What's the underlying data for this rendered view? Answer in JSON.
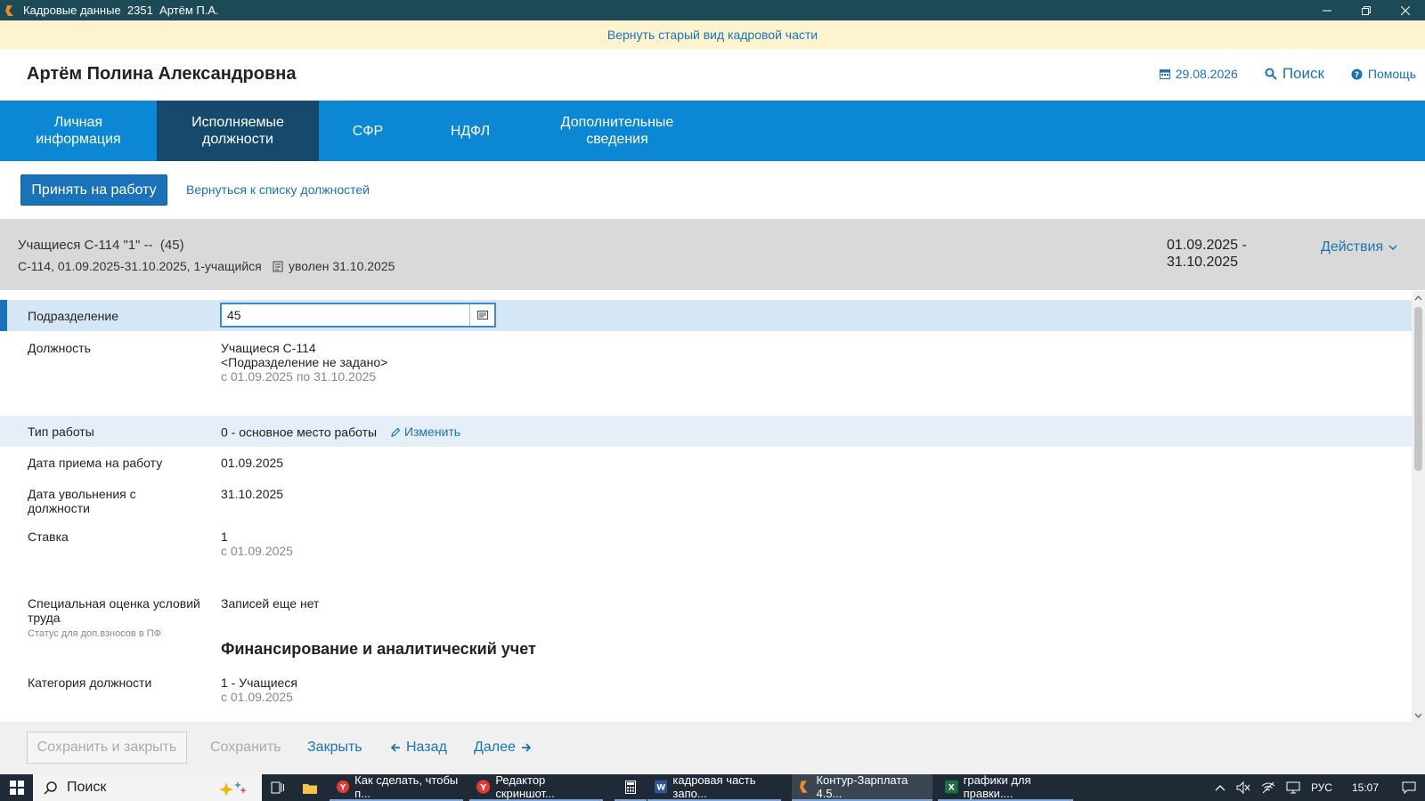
{
  "window": {
    "title": "Кадровые данные  2351  Артём П.А."
  },
  "banner": {
    "link_label": "Вернуть старый вид кадровой части"
  },
  "header": {
    "person_name": "Артём Полина Александровна",
    "date": "29.08.2026",
    "search_label": "Поиск",
    "help_label": "Помощь"
  },
  "tabs": [
    {
      "label": "Личная\nинформация",
      "active": false
    },
    {
      "label": "Исполняемые\nдолжности",
      "active": true
    },
    {
      "label": "СФР",
      "active": false
    },
    {
      "label": "НДФЛ",
      "active": false
    },
    {
      "label": "Дополнительные\nсведения",
      "active": false
    }
  ],
  "actions": {
    "hire_label": "Принять на работу",
    "back_label": "Вернуться к списку должностей"
  },
  "position": {
    "title": "Учащиеся С-114 \"1\" --  (45)",
    "subtitle": "С-114, 01.09.2025-31.10.2025, 1-учащийся",
    "status": "уволен 31.10.2025",
    "period_start": "01.09.2025 -",
    "period_end": "31.10.2025",
    "actions_label": "Действия"
  },
  "form": {
    "department_label": "Подразделение",
    "department_value": "45",
    "job_label": "Должность",
    "job_value_1": "Учащиеся С-114",
    "job_value_2": "<Подразделение не задано>",
    "job_period": "с 01.09.2025 по 31.10.2025",
    "work_type_label": "Тип работы",
    "work_type_value": "0 - основное место работы",
    "change_label": "Изменить",
    "hire_date_label": "Дата приема на работу",
    "hire_date_value": "01.09.2025",
    "dismiss_date_label": "Дата увольнения с должности",
    "dismiss_date_value": "31.10.2025",
    "rate_label": "Ставка",
    "rate_value": "1",
    "rate_since": "с 01.09.2025",
    "sout_label": "Специальная оценка условий труда",
    "sout_sub": "Статус для доп.взносов в ПФ",
    "sout_value": "Записей еще нет",
    "finance_section": "Финансирование и аналитический учет",
    "category_label": "Категория должности",
    "category_value": "1 - Учащиеся",
    "category_since": "с 01.09.2025"
  },
  "footer": {
    "save_close": "Сохранить и закрыть",
    "save": "Сохранить",
    "close": "Закрыть",
    "back": "Назад",
    "next": "Далее"
  },
  "taskbar": {
    "search": "Поиск",
    "apps": [
      {
        "label": "Как сделать, чтобы п...",
        "active": false
      },
      {
        "label": "Редактор скриншот...",
        "active": false
      },
      {
        "label": "кадровая часть запо...",
        "active": false
      },
      {
        "label": "Контур-Зарплата 4.5...",
        "active": true
      },
      {
        "label": "графики для правки....",
        "active": false
      }
    ],
    "lang": "РУС",
    "time": "15:07"
  },
  "colors": {
    "accent": "#1a73b8",
    "tabs_bg": "#0b87d3",
    "tab_active": "#164a6c",
    "titlebar": "#1c4b57",
    "banner": "#fdf3cf"
  }
}
